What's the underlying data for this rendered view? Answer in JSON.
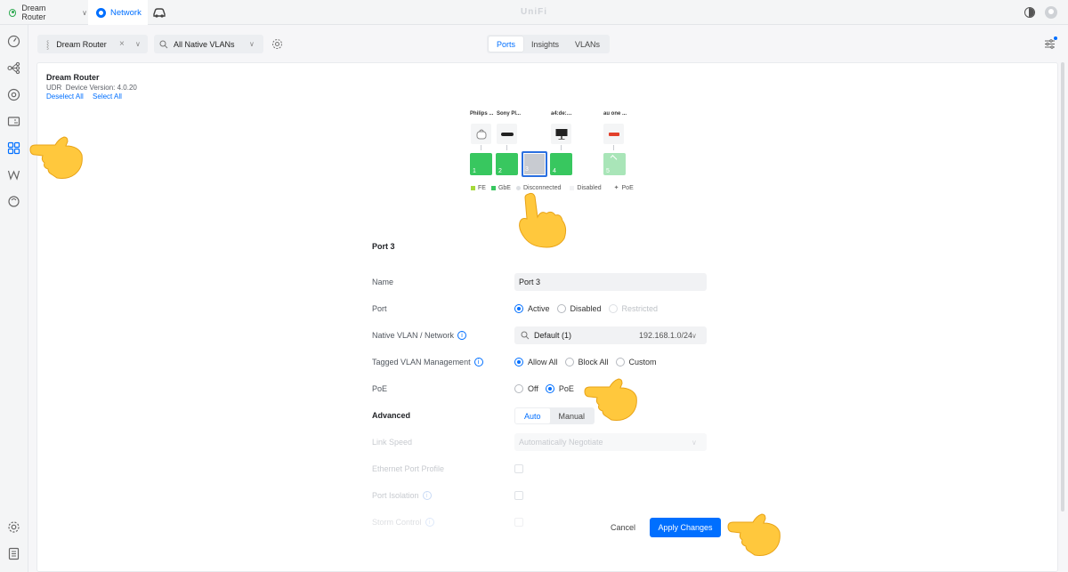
{
  "topbar": {
    "device": "Dream Router",
    "app": "Network",
    "brand": "UniFi"
  },
  "subbar": {
    "device_select": "Dream Router",
    "vlan_select": "All Native VLANs",
    "tabs": [
      "Ports",
      "Insights",
      "VLANs"
    ],
    "active_tab": "Ports"
  },
  "panel": {
    "title": "Dream Router",
    "model": "UDR",
    "version_text": "Device Version: 4.0.20",
    "deselect_all": "Deselect All",
    "select_all": "Select All"
  },
  "devices": [
    {
      "label": "Philips ...",
      "icon": "hub-device-icon"
    },
    {
      "label": "Sony Pl...",
      "icon": "console-device-icon"
    },
    {
      "label": "a4:de:…",
      "icon": "monitor-device-icon"
    },
    {
      "label": "au one ...",
      "icon": "router-device-icon"
    }
  ],
  "ports": [
    {
      "number": "1",
      "state": "GbE"
    },
    {
      "number": "2",
      "state": "GbE"
    },
    {
      "number": "3",
      "state": "Disconnected",
      "selected": true
    },
    {
      "number": "4",
      "state": "GbE"
    },
    {
      "number": "5",
      "state": "PoE"
    }
  ],
  "legend": {
    "fe": "FE",
    "gbe": "GbE",
    "disconnected": "Disconnected",
    "disabled": "Disabled",
    "poe": "PoE"
  },
  "colors": {
    "accent": "#006fff",
    "gbe": "#38c75f",
    "fe": "#a5d93a",
    "disconnected": "#c8cbd1"
  },
  "form": {
    "title": "Port 3",
    "name_label": "Name",
    "name_value": "Port 3",
    "port_label": "Port",
    "port_options": [
      "Active",
      "Disabled",
      "Restricted"
    ],
    "native_vlan_label": "Native VLAN / Network",
    "native_vlan_value": "Default (1)",
    "native_vlan_subnet": "192.168.1.0/24",
    "tagged_label": "Tagged VLAN Management",
    "tagged_options": [
      "Allow All",
      "Block All",
      "Custom"
    ],
    "poe_label": "PoE",
    "poe_options": [
      "Off",
      "PoE"
    ],
    "advanced_label": "Advanced",
    "advanced_options": [
      "Auto",
      "Manual"
    ],
    "link_speed_label": "Link Speed",
    "link_speed_value": "Automatically Negotiate",
    "ethernet_profile_label": "Ethernet Port Profile",
    "port_isolation_label": "Port Isolation",
    "storm_control_label": "Storm Control",
    "cancel": "Cancel",
    "apply": "Apply Changes"
  }
}
